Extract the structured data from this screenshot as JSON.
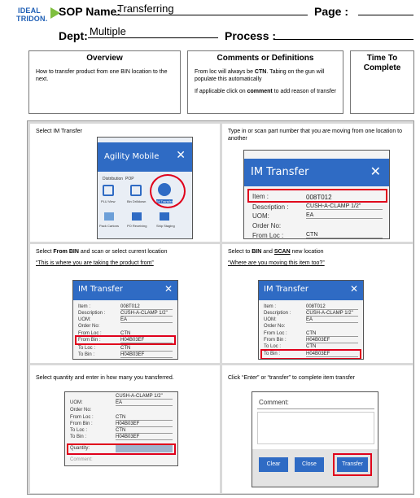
{
  "logo": {
    "line1": "IDEAL",
    "line2": "TRIDON."
  },
  "header": {
    "sop_label": "SOP Name:",
    "sop_value": "Transferring",
    "page_label": "Page :",
    "dept_label": "Dept:",
    "dept_value": "Multiple",
    "process_label": "Process :"
  },
  "overview": {
    "title": "Overview",
    "text": "How to transfer product from one BIN location to the next."
  },
  "comments": {
    "title": "Comments or Definitions",
    "line1a": "From loc will always be ",
    "line1b": "CTN",
    "line1c": ". Tabing on the gun will populate this automatically",
    "line2a": "If applicable click on ",
    "line2b": "comment",
    "line2c": " to add reason of transfer"
  },
  "time": {
    "title": "Time To Complete"
  },
  "steps": {
    "s1": {
      "caption": "Select IM Transfer"
    },
    "s2": {
      "caption": "Type in or scan part number that you are moving from one location to another"
    },
    "s3": {
      "caption_pre": "Select ",
      "caption_b1": "From BIN",
      "caption_mid": "  and scan or select current location",
      "note": "“This is where you are taking the product from”"
    },
    "s4": {
      "caption_pre": "Select to ",
      "caption_b1": "BIN",
      "caption_mid": " and ",
      "caption_b2": "SCAN",
      "caption_post": "  new location",
      "note": "“Where are you moving this item too?”"
    },
    "s5": {
      "caption": "Select quantity and enter in how many you transferred."
    },
    "s6": {
      "caption": "Click “Enter” or “transfer” to complete item transfer"
    }
  },
  "screens": {
    "agility": {
      "title": "Agility Mobile",
      "close": "✕",
      "tab1": "Distribution",
      "tab2": "POP",
      "icons": [
        "PLU View",
        "Bin Drilldown",
        "IM Transfer",
        "Pack Cartons",
        "PO Receiving",
        "Ship Staging"
      ]
    },
    "im": {
      "title": "IM Transfer",
      "close": "✕"
    },
    "fields": {
      "item": "Item :",
      "desc": "Description :",
      "uom": "UOM:",
      "order": "Order No:",
      "fromloc": "From Loc :",
      "frombin": "From Bin :",
      "toloc": "To Loc :",
      "tobin": "To Bin :",
      "qty": "Quantity:",
      "comment": "Comment:"
    },
    "values": {
      "item": "008T012",
      "desc": "CUSH-A-CLAMP 1/2\"",
      "uom": "EA",
      "ctn": "CTN",
      "bin": "H04B03EF"
    },
    "buttons": {
      "clear": "Clear",
      "close": "Close",
      "transfer": "Transfer"
    }
  }
}
